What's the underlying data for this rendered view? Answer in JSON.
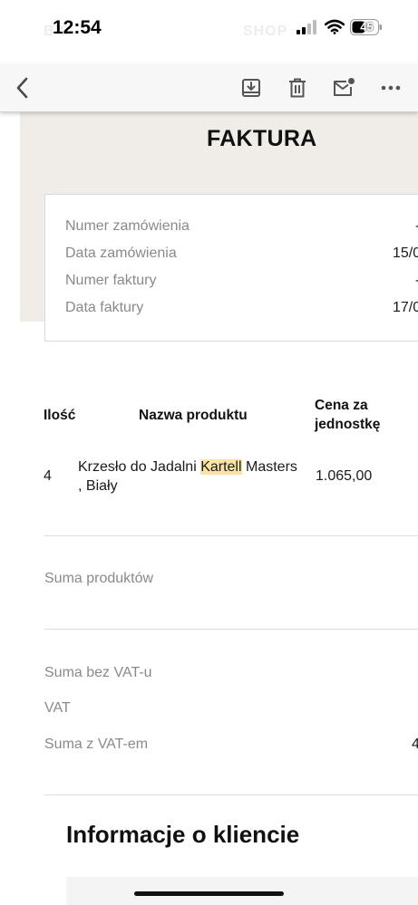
{
  "status_bar": {
    "time": "12:54",
    "battery": "45",
    "ghost_left": "B S",
    "ghost_right": "SHOP"
  },
  "toolbar": {
    "icons": [
      "back-icon",
      "archive-icon",
      "trash-icon",
      "mark-unread-icon",
      "more-icon"
    ]
  },
  "invoice": {
    "title": "FAKTURA",
    "info": [
      {
        "label": "Numer zamówienia",
        "value": "-"
      },
      {
        "label": "Data zamówienia",
        "value": "15/0"
      },
      {
        "label": "Numer faktury",
        "value": "-"
      },
      {
        "label": "Data faktury",
        "value": "17/0"
      }
    ],
    "table": {
      "headers": {
        "qty": "Ilość",
        "name": "Nazwa produktu",
        "price_line1": "Cena za",
        "price_line2": "jednostkę"
      },
      "rows": [
        {
          "qty": "4",
          "name_before": "Krzesło do Jadalni ",
          "name_highlight": "Kartell",
          "name_after": " Masters",
          "name_line2": ", Biały",
          "price": "1.065,00"
        }
      ]
    },
    "sums": {
      "products_label": "Suma produktów",
      "net_label": "Suma bez VAT-u",
      "vat_label": "VAT",
      "gross_label": "Suma z VAT-em",
      "gross_value_partial": "4"
    },
    "customer_section_title": "Informacje o kliencie"
  },
  "colors": {
    "beige_header": "#f0ede9",
    "highlight": "#fbe3a4",
    "label_grey": "#8a8a8a"
  }
}
